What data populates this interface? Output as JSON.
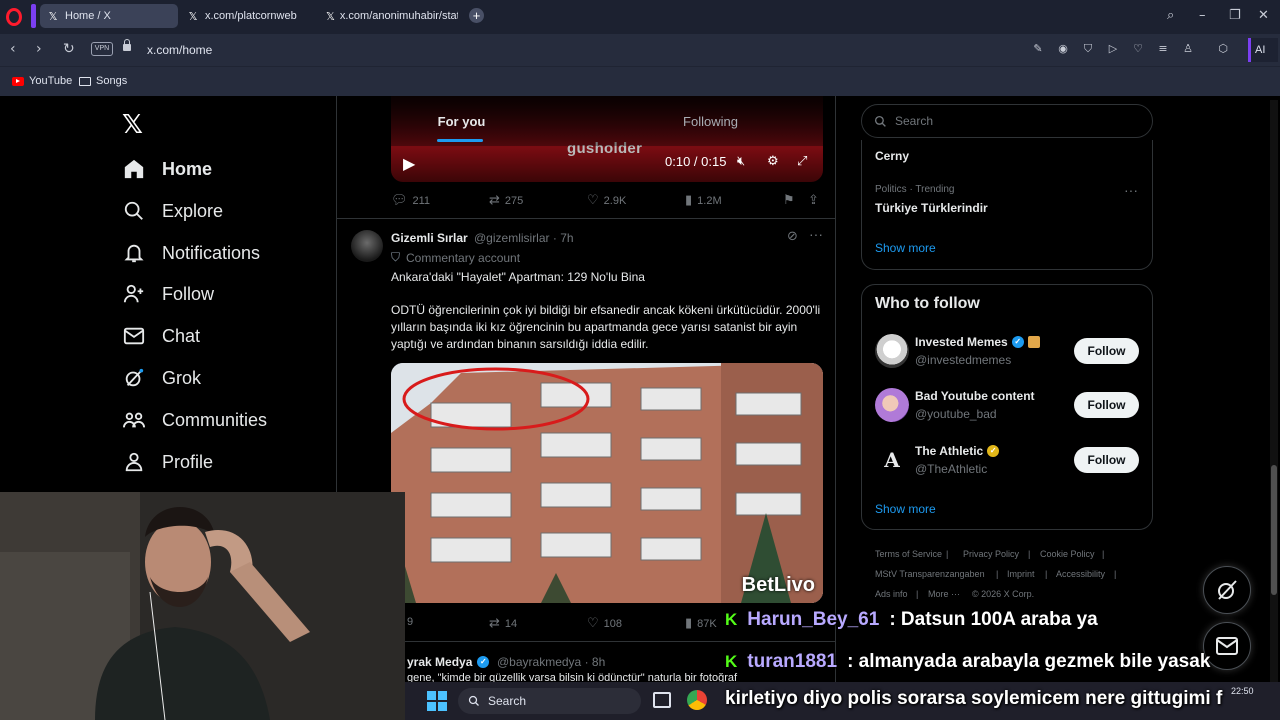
{
  "browser": {
    "tabs": [
      {
        "label": "Home / X"
      },
      {
        "label": "x.com/platcornweb"
      },
      {
        "label": "x.com/anonimuhabir/statu"
      }
    ],
    "url": "x.com/home",
    "vpn_label": "VPN",
    "ai_label": "AI",
    "bookmarks": [
      {
        "label": "YouTube"
      },
      {
        "label": "Songs"
      }
    ]
  },
  "nav": {
    "items": [
      {
        "label": "Home",
        "icon": "home-icon"
      },
      {
        "label": "Explore",
        "icon": "search-icon"
      },
      {
        "label": "Notifications",
        "icon": "bell-icon"
      },
      {
        "label": "Follow",
        "icon": "person-plus-icon"
      },
      {
        "label": "Chat",
        "icon": "mail-icon"
      },
      {
        "label": "Grok",
        "icon": "grok-icon"
      },
      {
        "label": "Communities",
        "icon": "people-icon"
      },
      {
        "label": "Profile",
        "icon": "person-icon"
      }
    ]
  },
  "feed": {
    "tabs": [
      "For you",
      "Following"
    ],
    "video": {
      "logo": "gusholder",
      "time": "0:10 / 0:15"
    },
    "tweet1_actions": {
      "replies": "211",
      "reposts": "275",
      "likes": "2.9K",
      "views": "1.2M"
    },
    "tweet2": {
      "name": "Gizemli Sırlar",
      "handle": "@gizemlisirlar",
      "time": "· 7h",
      "label": "Commentary account",
      "title": "Ankara'daki \"Hayalet\" Apartman: 129 No'lu Bina",
      "body": "ODTÜ öğrencilerinin çok iyi bildiği bir efsanedir ancak kökeni ürkütücüdür. 2000'li yılların başında iki kız öğrencinin bu apartmanda gece yarısı satanist bir ayin yaptığı ve ardından binanın sarsıldığı iddia edilir.",
      "watermark": "BetLivo",
      "actions": {
        "replies": "9",
        "reposts": "14",
        "likes": "108",
        "views": "87K"
      }
    },
    "tweet3": {
      "name": "yrak Medya",
      "handle": "@bayrakmedya",
      "time": "· 8h",
      "snippet": "gene, \"kimde bir güzellik varsa bilsin ki ödünctür\" naturla bir fotoğraf"
    }
  },
  "right": {
    "search_placeholder": "Search",
    "trends": [
      {
        "category": "",
        "name": "Cerny"
      },
      {
        "category": "Politics · Trending",
        "name": "Türkiye Türklerindir"
      }
    ],
    "show_more": "Show more",
    "who_to_follow_title": "Who to follow",
    "who_to_follow": [
      {
        "name": "Invested Memes",
        "handle": "@investedmemes",
        "button": "Follow"
      },
      {
        "name": "Bad Youtube content",
        "handle": "@youtube_bad",
        "button": "Follow"
      },
      {
        "name": "The Athletic",
        "handle": "@TheAthletic",
        "button": "Follow"
      }
    ],
    "show_more_2": "Show more",
    "footer": [
      "Terms of Service",
      "Privacy Policy",
      "Cookie Policy",
      "MStV Transparenzangaben",
      "Imprint",
      "Accessibility",
      "Ads info",
      "More ···",
      "© 2026 X Corp."
    ]
  },
  "chat": [
    {
      "user": "Harun_Bey_61",
      "message": ": Datsun 100A araba ya"
    },
    {
      "user": "turan1881",
      "message": ": almanyada arabayla gezmek bile yasak"
    },
    {
      "user": "",
      "message": "kirletiyo diyo polis sorarsa soylemicem nere gittugimi f"
    }
  ],
  "taskbar": {
    "search_label": "Search",
    "time": "22:50"
  },
  "colors": {
    "accent": "#1d9bf0",
    "background": "#000000",
    "chat_user": "#b8a9ff",
    "chat_badge": "#53fc18"
  }
}
